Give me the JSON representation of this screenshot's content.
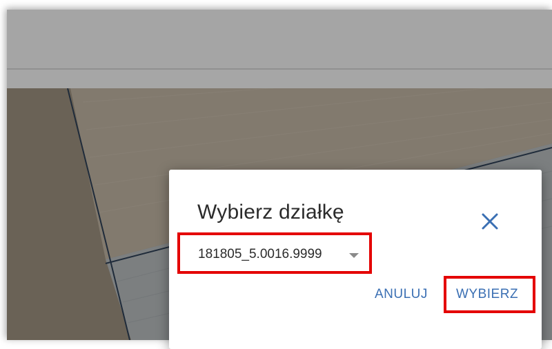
{
  "dialog": {
    "title": "Wybierz działkę",
    "selected_parcel": "181805_5.0016.9999",
    "cancel_label": "ANULUJ",
    "choose_label": "WYBIERZ"
  },
  "icons": {
    "close": "close-icon",
    "dropdown": "chevron-down-icon"
  },
  "colors": {
    "accent": "#3a6fb3",
    "highlight": "#e40000"
  }
}
